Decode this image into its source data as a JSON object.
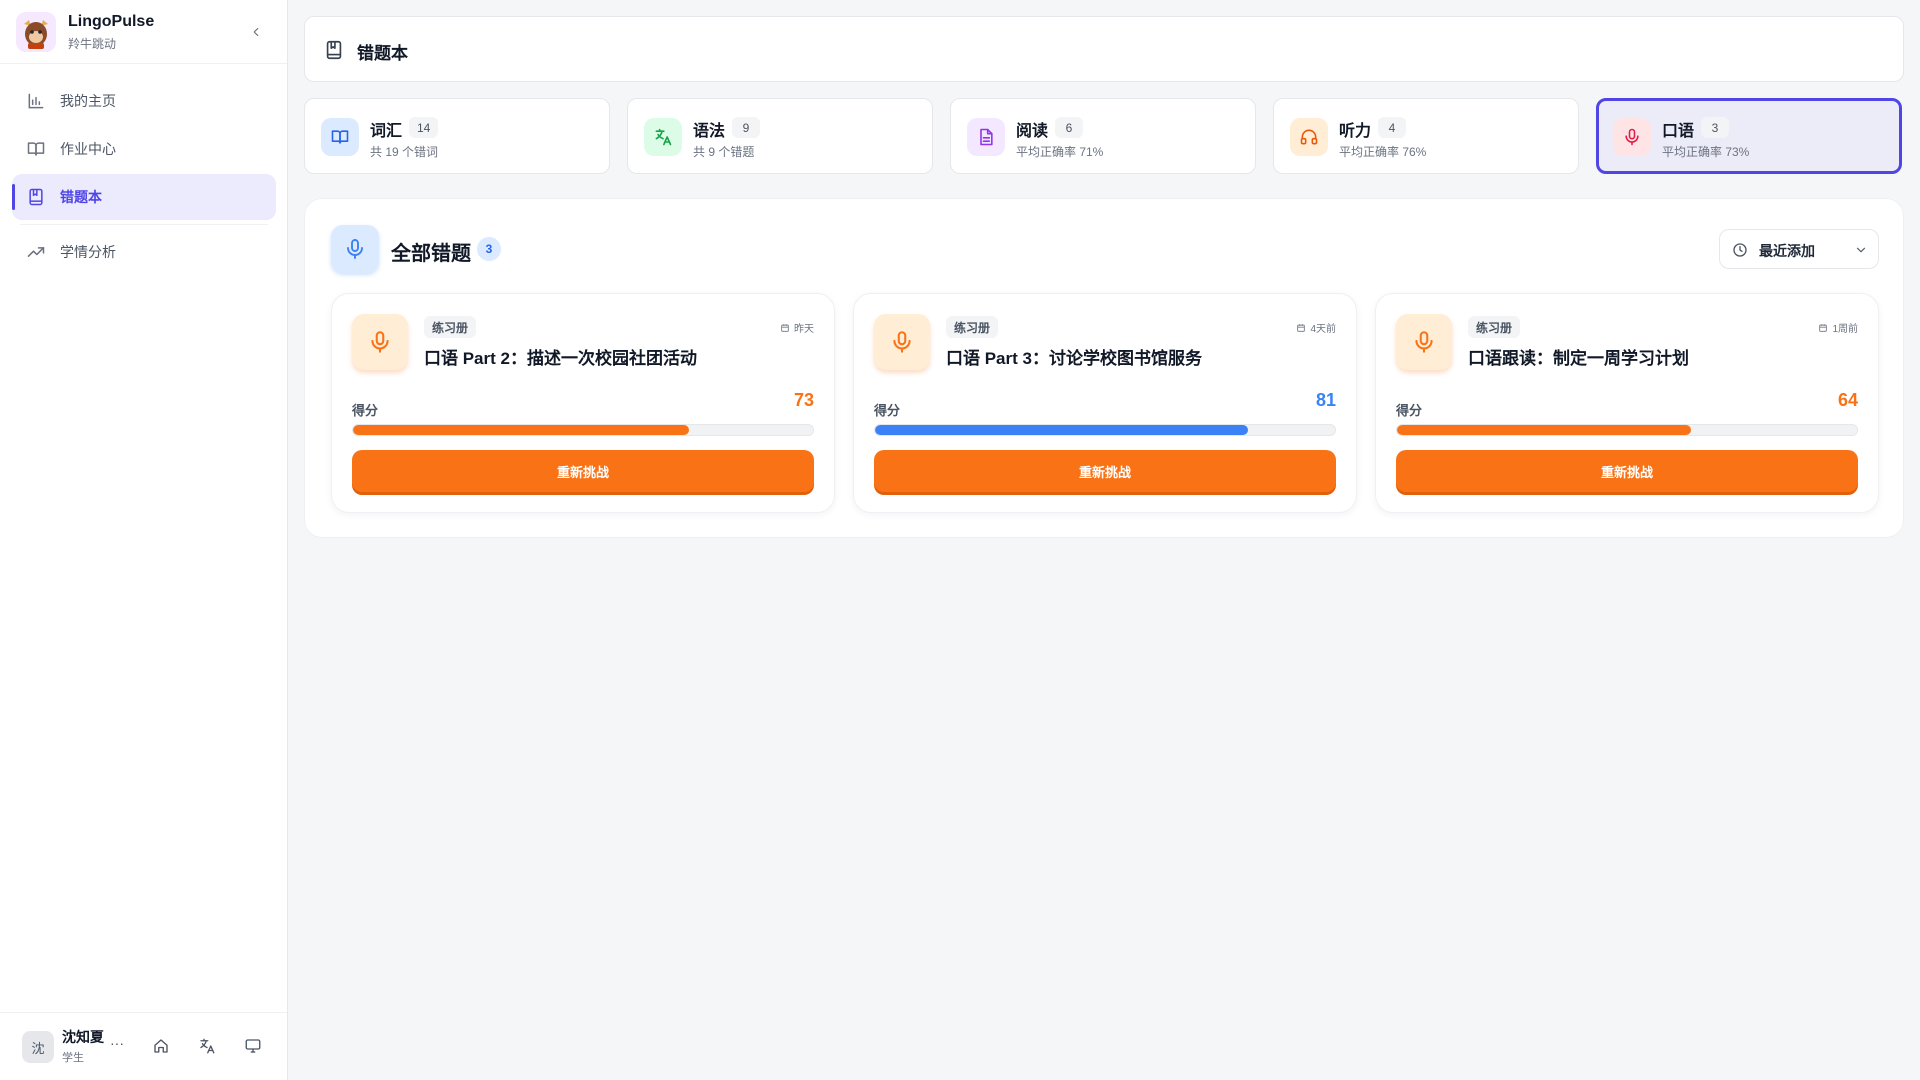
{
  "app": {
    "name": "LingoPulse",
    "subtitle": "羚牛跳动"
  },
  "nav": [
    {
      "label": "我的主页",
      "icon": "bar-chart-icon",
      "active": false
    },
    {
      "label": "作业中心",
      "icon": "book-open-icon",
      "active": false
    },
    {
      "label": "错题本",
      "icon": "bookmark-book-icon",
      "active": true
    },
    {
      "label": "学情分析",
      "icon": "trending-up-icon",
      "active": false
    }
  ],
  "user": {
    "avatar_char": "沈",
    "name": "沈知夏",
    "role": "学生",
    "more": "···"
  },
  "header": {
    "title": "错题本"
  },
  "categories": [
    {
      "name": "词汇",
      "count": "14",
      "sub": "共 19 个错词",
      "icon": "book-open-icon",
      "color": "#2563eb",
      "bg": "#dbeafe"
    },
    {
      "name": "语法",
      "count": "9",
      "sub": "共 9 个错题",
      "icon": "translate-icon",
      "color": "#16a34a",
      "bg": "#dcfce7"
    },
    {
      "name": "阅读",
      "count": "6",
      "sub": "平均正确率 71%",
      "icon": "document-icon",
      "color": "#9333ea",
      "bg": "#f3e8ff"
    },
    {
      "name": "听力",
      "count": "4",
      "sub": "平均正确率 76%",
      "icon": "headphones-icon",
      "color": "#ea580c",
      "bg": "#ffedd5"
    },
    {
      "name": "口语",
      "count": "3",
      "sub": "平均正确率 73%",
      "icon": "microphone-icon",
      "color": "#e11d48",
      "bg": "#ffe4e6",
      "active": true
    }
  ],
  "panel": {
    "title": "全部错题",
    "count": "3",
    "sort": {
      "label": "最近添加"
    }
  },
  "cards": [
    {
      "tag": "练习册",
      "date": "昨天",
      "title": "口语 Part 2：描述一次校园社团活动",
      "score_label": "得分",
      "score": 73,
      "score_color": "#f97316",
      "bar_color": "#f97316",
      "button": "重新挑战"
    },
    {
      "tag": "练习册",
      "date": "4天前",
      "title": "口语 Part 3：讨论学校图书馆服务",
      "score_label": "得分",
      "score": 81,
      "score_color": "#3b82f6",
      "bar_color": "#3b82f6",
      "button": "重新挑战"
    },
    {
      "tag": "练习册",
      "date": "1周前",
      "title": "口语跟读：制定一周学习计划",
      "score_label": "得分",
      "score": 64,
      "score_color": "#f97316",
      "bar_color": "#f97316",
      "button": "重新挑战"
    }
  ]
}
